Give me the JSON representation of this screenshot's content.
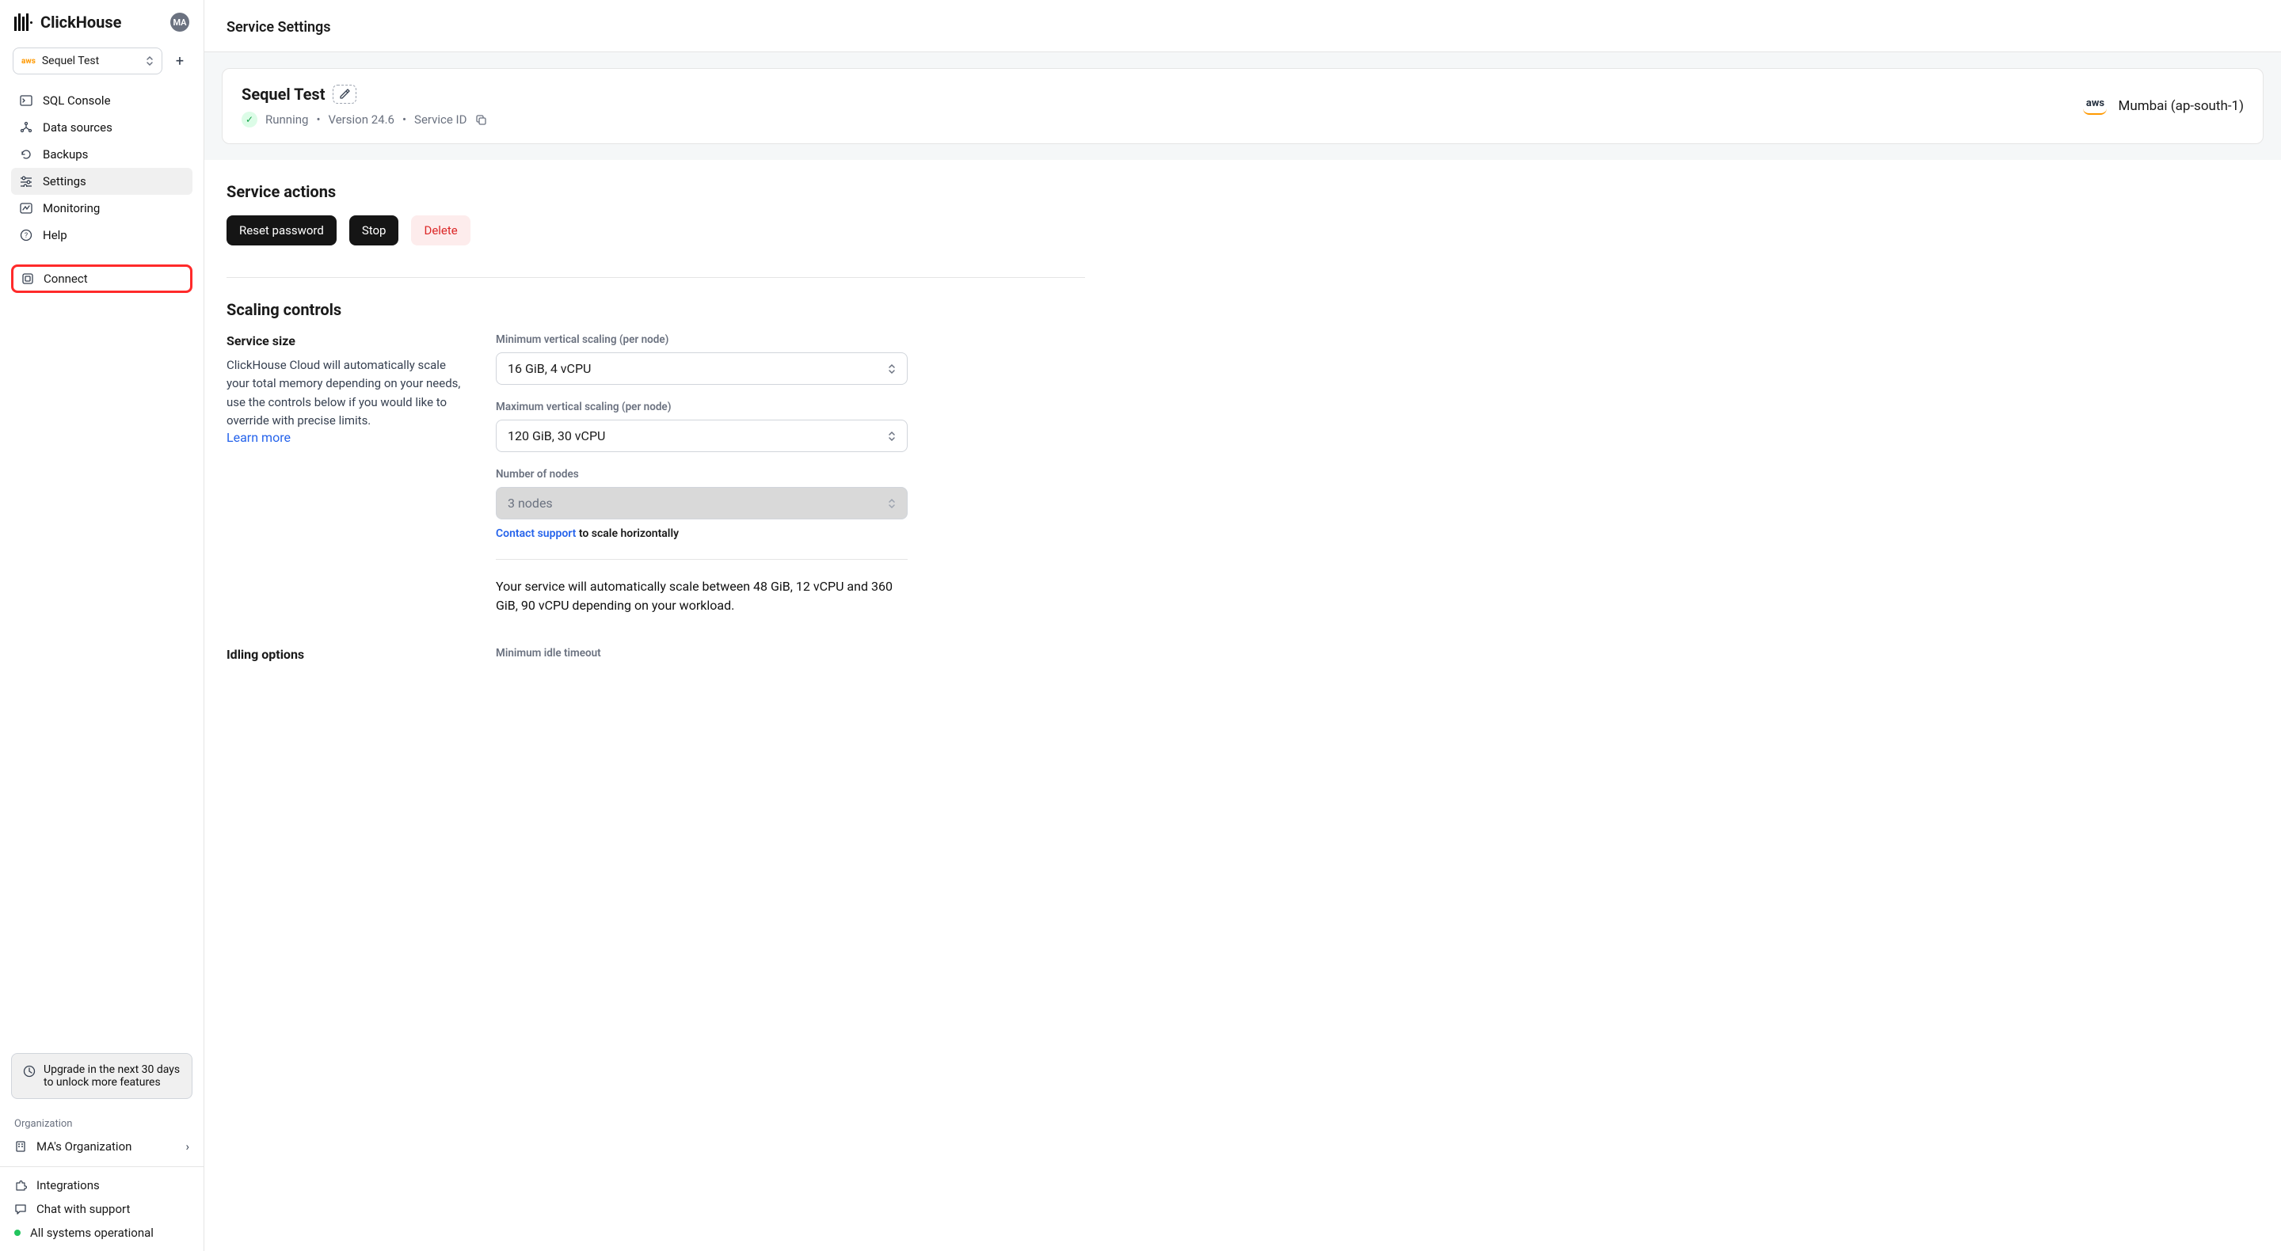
{
  "brand": "ClickHouse",
  "avatar": "MA",
  "service_selector": {
    "value": "Sequel Test"
  },
  "sidebar": {
    "items": [
      {
        "label": "SQL Console"
      },
      {
        "label": "Data sources"
      },
      {
        "label": "Backups"
      },
      {
        "label": "Settings"
      },
      {
        "label": "Monitoring"
      },
      {
        "label": "Help"
      }
    ],
    "connect": "Connect",
    "upgrade": "Upgrade in the next 30 days to unlock more features",
    "org_heading": "Organization",
    "org_name": "MA's Organization",
    "bottom": {
      "integrations": "Integrations",
      "chat": "Chat with support",
      "status": "All systems operational"
    }
  },
  "page_title": "Service Settings",
  "hero": {
    "name": "Sequel Test",
    "status": "Running",
    "version": "Version 24.6",
    "service_id_label": "Service ID",
    "region": "Mumbai (ap-south-1)",
    "provider": "aws"
  },
  "actions": {
    "heading": "Service actions",
    "reset": "Reset password",
    "stop": "Stop",
    "delete": "Delete"
  },
  "scaling": {
    "heading": "Scaling controls",
    "size_heading": "Service size",
    "size_desc": "ClickHouse Cloud will automatically scale your total memory depending on your needs, use the controls below if you would like to override with precise limits.",
    "learn_more": "Learn more",
    "min_label": "Minimum vertical scaling (per node)",
    "min_value": "16 GiB, 4 vCPU",
    "max_label": "Maximum vertical scaling (per node)",
    "max_value": "120 GiB, 30 vCPU",
    "nodes_label": "Number of nodes",
    "nodes_value": "3 nodes",
    "contact": "Contact support",
    "contact_suffix": " to scale horizontally",
    "auto_note": "Your service will automatically scale between 48 GiB, 12 vCPU and 360 GiB, 90 vCPU depending on your workload."
  },
  "idling": {
    "heading": "Idling options",
    "min_idle_label": "Minimum idle timeout"
  }
}
